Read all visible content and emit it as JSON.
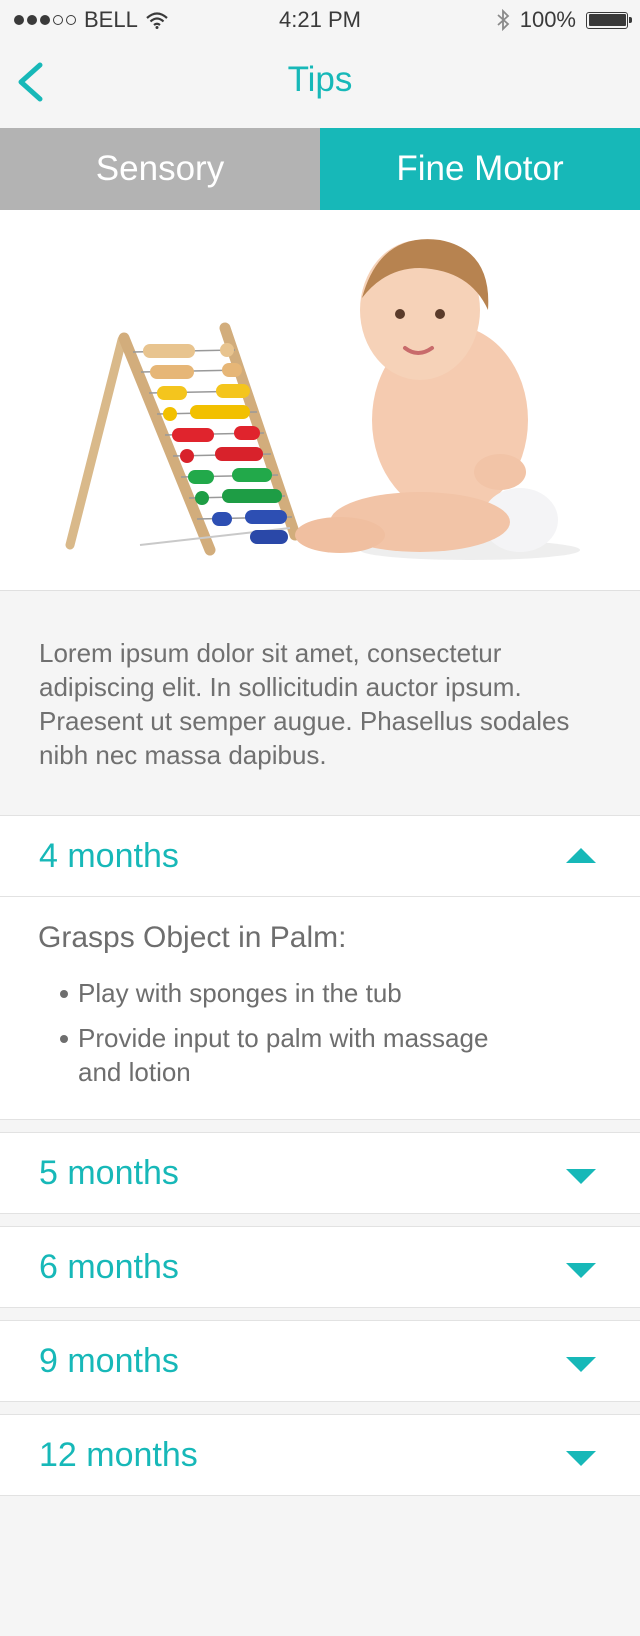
{
  "status_bar": {
    "carrier": "BELL",
    "time": "4:21 PM",
    "battery": "100%"
  },
  "nav": {
    "title": "Tips",
    "back_icon": "chevron-left-icon"
  },
  "tabs": [
    {
      "label": "Sensory",
      "active": false
    },
    {
      "label": "Fine Motor",
      "active": true
    }
  ],
  "intro_text": "Lorem ipsum dolor sit amet, consectetur adipiscing elit. In sollicitudin auctor ipsum. Praesent ut semper augue. Phasellus sodales nibh nec massa dapibus.",
  "sections": [
    {
      "label": "4 months",
      "expanded": true,
      "content": {
        "title": "Grasps Object in Palm:",
        "bullets": [
          "Play with sponges in the tub",
          "Provide input to palm with massage and lotion"
        ]
      }
    },
    {
      "label": "5 months",
      "expanded": false
    },
    {
      "label": "6 months",
      "expanded": false
    },
    {
      "label": "9 months",
      "expanded": false
    },
    {
      "label": "12 months",
      "expanded": false
    }
  ],
  "colors": {
    "accent": "#17b8b8",
    "tab_inactive": "#b3b3b3",
    "background": "#f5f5f5",
    "text": "#6e6e6e"
  }
}
